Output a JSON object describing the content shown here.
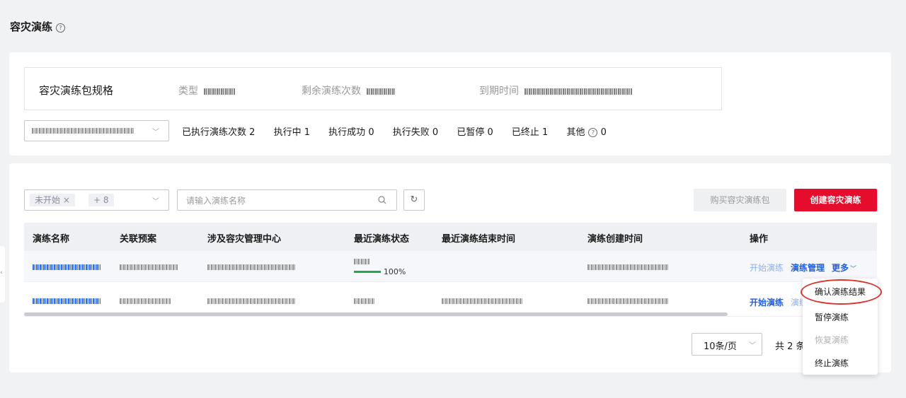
{
  "page": {
    "title": "容灾演练",
    "help_icon": "?"
  },
  "spec": {
    "title": "容灾演练包规格",
    "type_label": "类型",
    "remaining_label": "剩余演练次数",
    "expire_label": "到期时间"
  },
  "stats": {
    "executed_label": "已执行演练次数",
    "executed": "2",
    "running_label": "执行中",
    "running": "1",
    "success_label": "执行成功",
    "success": "0",
    "failed_label": "执行失败",
    "failed": "0",
    "paused_label": "已暂停",
    "paused": "0",
    "stopped_label": "已终止",
    "stopped": "1",
    "other_label": "其他",
    "other": "0"
  },
  "filter": {
    "tag": "未开始",
    "tag_close": "×",
    "more_tag": "+ 8"
  },
  "search": {
    "placeholder": "请输入演练名称"
  },
  "actions": {
    "buy": "购买容灾演练包",
    "create": "创建容灾演练"
  },
  "table": {
    "columns": [
      "演练名称",
      "关联预案",
      "涉及容灾管理中心",
      "最近演练状态",
      "最近演练结束时间",
      "演练创建时间",
      "操作"
    ],
    "rows": [
      {
        "progress": "100%",
        "ops": [
          "开始演练",
          "演练管理",
          "更多"
        ]
      },
      {
        "ops": [
          "开始演练",
          "演练"
        ]
      }
    ]
  },
  "pagination": {
    "page_size": "10条/页",
    "total": "共 2 条"
  },
  "more_menu": {
    "items": [
      {
        "label": "确认演练结果",
        "disabled": false
      },
      {
        "label": "暂停演练",
        "disabled": false
      },
      {
        "label": "恢复演练",
        "disabled": true
      },
      {
        "label": "终止演练",
        "disabled": false
      }
    ]
  },
  "colors": {
    "accent": "#e60c2b",
    "link": "#3b6ee8",
    "success": "#20a74f",
    "highlight": "#d9362d"
  }
}
